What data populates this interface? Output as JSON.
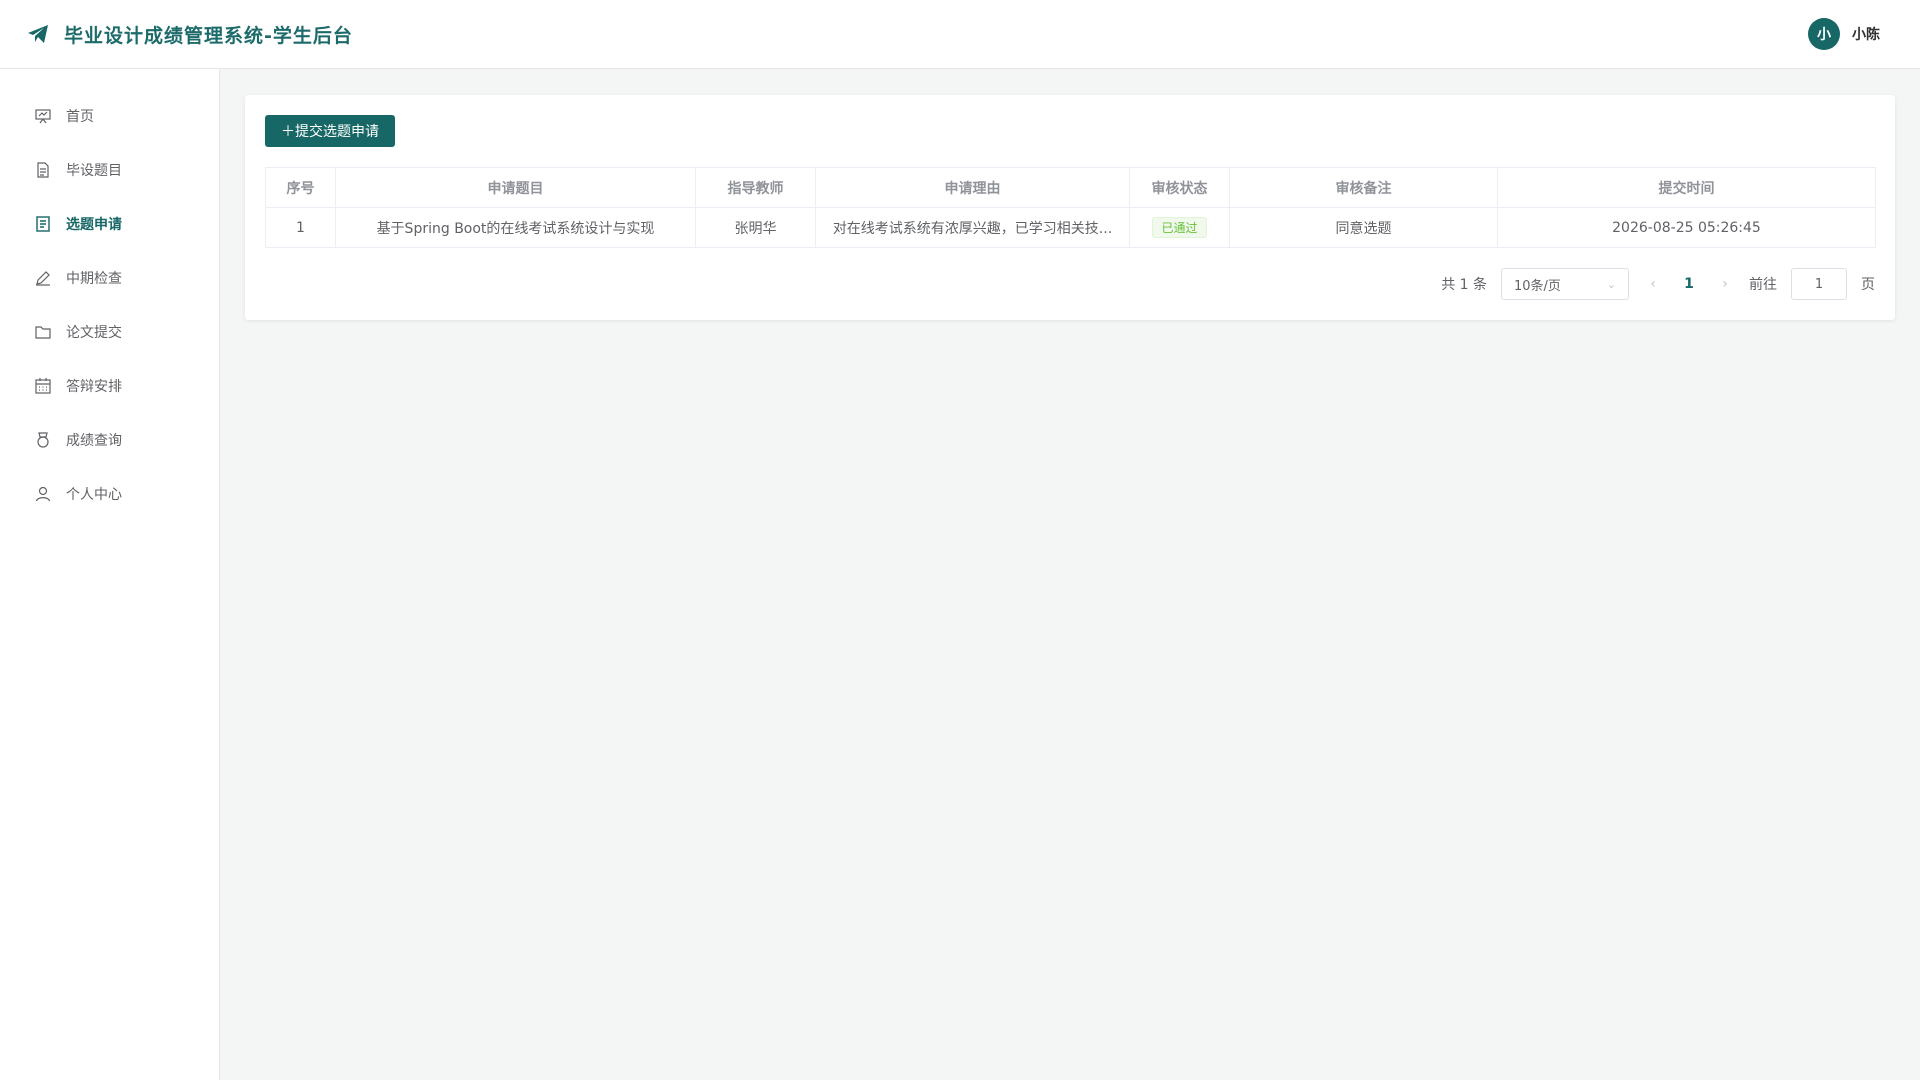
{
  "header": {
    "title": "毕业设计成绩管理系统-学生后台",
    "avatar_text": "小",
    "username": "小陈"
  },
  "sidebar": {
    "items": [
      {
        "label": "首页",
        "icon": "presentation-icon"
      },
      {
        "label": "毕设题目",
        "icon": "document-icon"
      },
      {
        "label": "选题申请",
        "icon": "list-document-icon",
        "active": true
      },
      {
        "label": "中期检查",
        "icon": "edit-pen-icon"
      },
      {
        "label": "论文提交",
        "icon": "folder-icon"
      },
      {
        "label": "答辩安排",
        "icon": "calendar-icon"
      },
      {
        "label": "成绩查询",
        "icon": "medal-icon"
      },
      {
        "label": "个人中心",
        "icon": "user-icon"
      }
    ]
  },
  "toolbar": {
    "submit_label": "＋提交选题申请"
  },
  "table": {
    "columns": [
      "序号",
      "申请题目",
      "指导教师",
      "申请理由",
      "审核状态",
      "审核备注",
      "提交时间"
    ],
    "rows": [
      {
        "index": "1",
        "topic": "基于Spring Boot的在线考试系统设计与实现",
        "teacher": "张明华",
        "reason": "对在线考试系统有浓厚兴趣，已学习相关技...",
        "status": "已通过",
        "remark": "同意选题",
        "time": "2026-08-25 05:26:45"
      }
    ]
  },
  "pagination": {
    "total_text": "共 1 条",
    "page_size": "10条/页",
    "current_page": "1",
    "goto_label": "前往",
    "goto_value": "1",
    "page_suffix": "页"
  },
  "colors": {
    "primary": "#176766",
    "success": "#67c23a"
  }
}
